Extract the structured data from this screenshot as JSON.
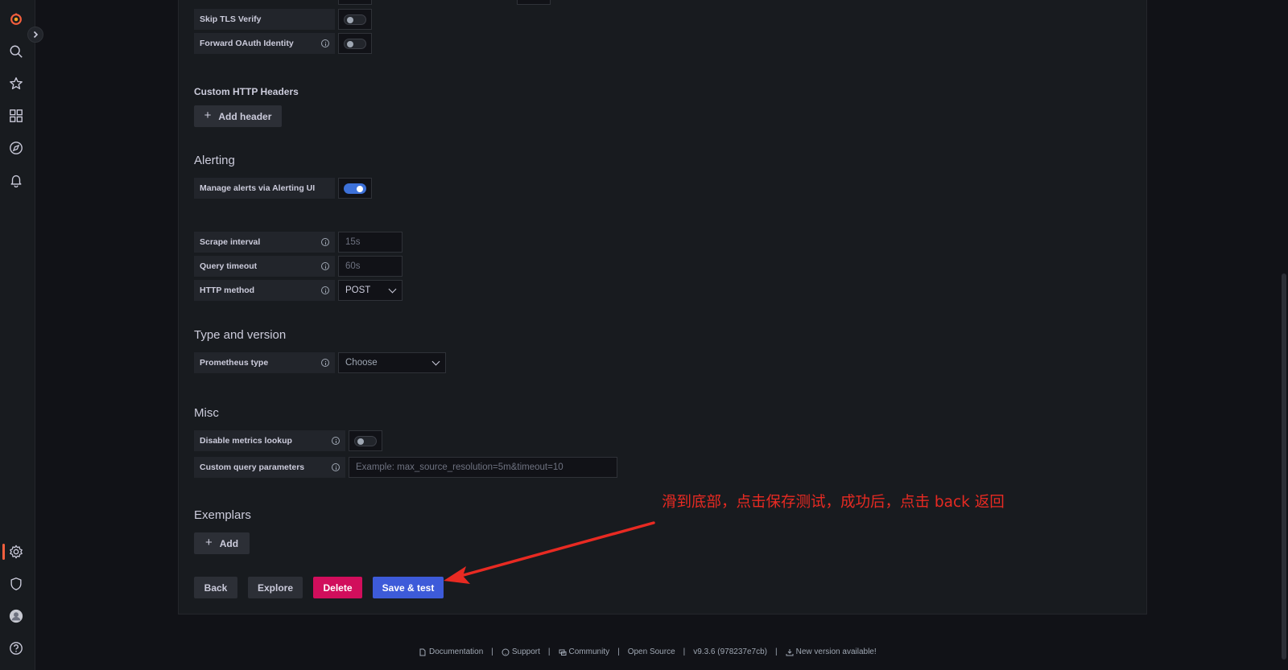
{
  "sidebar": {
    "logo": "grafana-logo-icon",
    "items": [
      "search-icon",
      "star-icon",
      "dashboards-icon",
      "explore-icon",
      "alerting-icon",
      "gear-icon",
      "shield-icon",
      "avatar",
      "help-icon"
    ],
    "accent": "#f55f3e"
  },
  "auth": {
    "skip_tls_label": "Skip TLS Verify",
    "forward_oauth_label": "Forward OAuth Identity"
  },
  "headers": {
    "title": "Custom HTTP Headers",
    "add_label": "Add header"
  },
  "alerting": {
    "title": "Alerting",
    "manage_label": "Manage alerts via Alerting UI",
    "manage_enabled": true
  },
  "settings": {
    "scrape_label": "Scrape interval",
    "scrape_placeholder": "15s",
    "timeout_label": "Query timeout",
    "timeout_placeholder": "60s",
    "method_label": "HTTP method",
    "method_value": "POST"
  },
  "type_version": {
    "title": "Type and version",
    "prom_type_label": "Prometheus type",
    "prom_type_value": "Choose"
  },
  "misc": {
    "title": "Misc",
    "disable_lookup_label": "Disable metrics lookup",
    "custom_params_label": "Custom query parameters",
    "custom_params_placeholder": "Example: max_source_resolution=5m&timeout=10"
  },
  "exemplars": {
    "title": "Exemplars",
    "add_label": "Add"
  },
  "actions": {
    "back": "Back",
    "explore": "Explore",
    "delete": "Delete",
    "save": "Save & test"
  },
  "annotation": "滑到底部，点击保存测试，成功后，点击 back 返回",
  "footer": {
    "documentation": "Documentation",
    "support": "Support",
    "community": "Community",
    "open_source": "Open Source",
    "version": "v9.3.6 (978237e7cb)",
    "new_version": "New version available!",
    "sep": "|"
  },
  "colors": {
    "background": "#111217",
    "panel": "#181b1f",
    "primary": "#3d5bd9",
    "danger": "#d10e5c",
    "annotation": "#e82a22"
  }
}
